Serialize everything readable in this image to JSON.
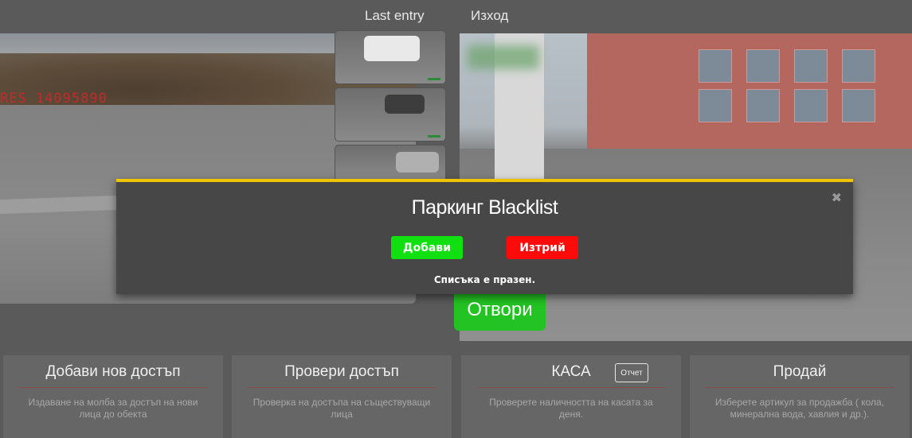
{
  "tabs": {
    "last_entry": "Last entry",
    "exit": "Изход"
  },
  "camera_left": {
    "overlay_text": "RES 14095890"
  },
  "open_button": {
    "label": "Отвори"
  },
  "modal": {
    "title": "Паркинг Blacklist",
    "close_icon": "close-icon",
    "add_label": "Добави",
    "delete_label": "Изтрий",
    "empty_text": "Списъка е празен.",
    "accent_color": "#f0c400"
  },
  "cards": [
    {
      "title": "Добави нов достъп",
      "desc": "Издаване на молба за достъп на нови лица до обекта"
    },
    {
      "title": "Провери достъп",
      "desc": "Проверка на достъпа на съществуващи лица"
    },
    {
      "title": "КАСА",
      "desc": "Проверете наличността на касата за деня.",
      "report_label": "Отчет"
    },
    {
      "title": "Продай",
      "desc": "Изберете артикул за продажба ( кола, минерална вода, хавлия и др.)."
    }
  ],
  "colors": {
    "open_green": "#22c322",
    "add_green": "#10e010",
    "delete_red": "#ff0a0a"
  }
}
